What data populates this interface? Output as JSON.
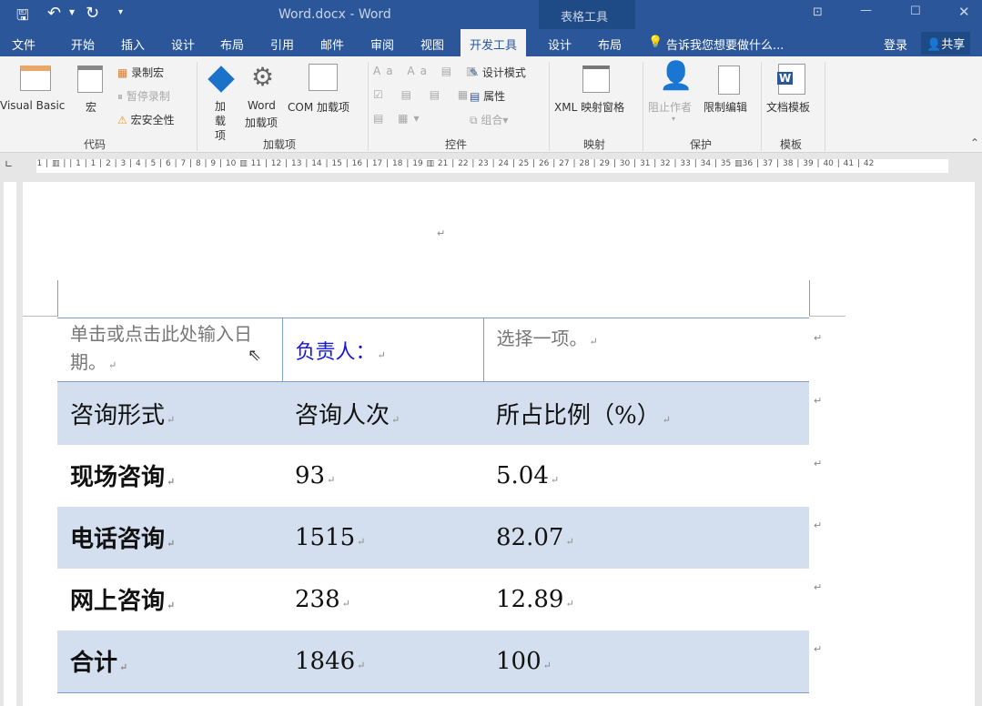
{
  "title": "Word.docx - Word",
  "context_tab": "表格工具",
  "tabs": [
    "文件",
    "开始",
    "插入",
    "设计",
    "布局",
    "引用",
    "邮件",
    "审阅",
    "视图",
    "开发工具",
    "设计",
    "布局"
  ],
  "tell_me": "告诉我您想要做什么...",
  "login": "登录",
  "share": "共享",
  "ribbon": {
    "code": {
      "label": "代码",
      "visual_basic": "Visual Basic",
      "macro": "宏",
      "record": "录制宏",
      "pause": "暂停录制",
      "security": "宏安全性"
    },
    "addins": {
      "label": "加载项",
      "addin": "加\n载项",
      "word_addin": "Word",
      "word_addin2": "加载项",
      "com": "COM 加载项"
    },
    "controls": {
      "label": "控件",
      "design": "设计模式",
      "props": "属性",
      "group": "组合"
    },
    "mapping": {
      "label": "映射",
      "xml": "XML 映射窗格"
    },
    "protect": {
      "label": "保护",
      "block": "阻止作者",
      "restrict": "限制编辑"
    },
    "templates": {
      "label": "模板",
      "doc_template": "文档模板"
    }
  },
  "ruler": "2 | 1 | ▥ | | 1 | 1 | 2 | 3 | 4 | 5 | 6 | 7 | 8 | 9 | 10 ▥ 11 | 12 | 13 | 14 | 15 | 16 | 17 | 18 | 19 ▥ 21 | 22 | 23 | 24 | 25 | 26 | 27 | 28 | 29 | 30 | 31 | 32 | 33 | 34 | 35 ▥36 | 37 | 38 | 39 | 40 | 41 | 42",
  "table": {
    "header": {
      "date": "单击或点击此处输入日期。",
      "owner": "负责人：",
      "choose": "选择一项。"
    },
    "columns": [
      "咨询形式",
      "咨询人次",
      "所占比例（%）"
    ],
    "rows": [
      [
        "现场咨询",
        "93",
        "5.04"
      ],
      [
        "电话咨询",
        "1515",
        "82.07"
      ],
      [
        "网上咨询",
        "238",
        "12.89"
      ],
      [
        "合计",
        "1846",
        "100"
      ]
    ]
  }
}
